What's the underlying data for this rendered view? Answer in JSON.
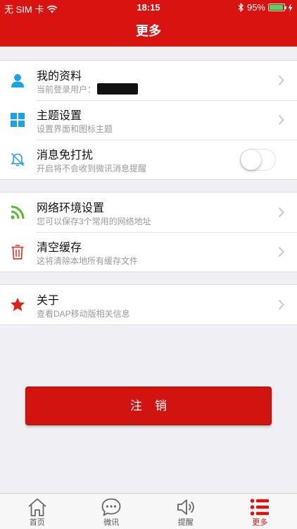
{
  "status_bar": {
    "carrier": "无 SIM 卡",
    "time": "18:15",
    "battery": "95%",
    "battery_level": 0.95
  },
  "nav": {
    "title": "更多"
  },
  "settings": {
    "profile": {
      "title": "我的资料",
      "subtitle": "当前登录用户："
    },
    "theme": {
      "title": "主题设置",
      "subtitle": "设置界面和图标主题"
    },
    "dnd": {
      "title": "消息免打扰",
      "subtitle": "开启将不会收到微讯消息提醒",
      "enabled": false
    },
    "network": {
      "title": "网络环境设置",
      "subtitle": "您可以保存3个常用的网络地址"
    },
    "cache": {
      "title": "清空缓存",
      "subtitle": "这将清除本地所有缓存文件"
    },
    "about": {
      "title": "关于",
      "subtitle": "查看DAP移动版相关信息"
    }
  },
  "logout_label": "注销",
  "tabs": [
    {
      "label": "首页",
      "icon": "home-icon",
      "active": false
    },
    {
      "label": "微讯",
      "icon": "chat-icon",
      "active": false
    },
    {
      "label": "提醒",
      "icon": "speaker-icon",
      "active": false
    },
    {
      "label": "更多",
      "icon": "list-icon",
      "active": true
    }
  ],
  "colors": {
    "brand_red": "#d9130f",
    "background": "#efeff4",
    "profile_icon": "#1aa3e8",
    "network_icon": "#5ab82e",
    "cache_icon": "#e33b36",
    "about_icon": "#e0201a"
  }
}
